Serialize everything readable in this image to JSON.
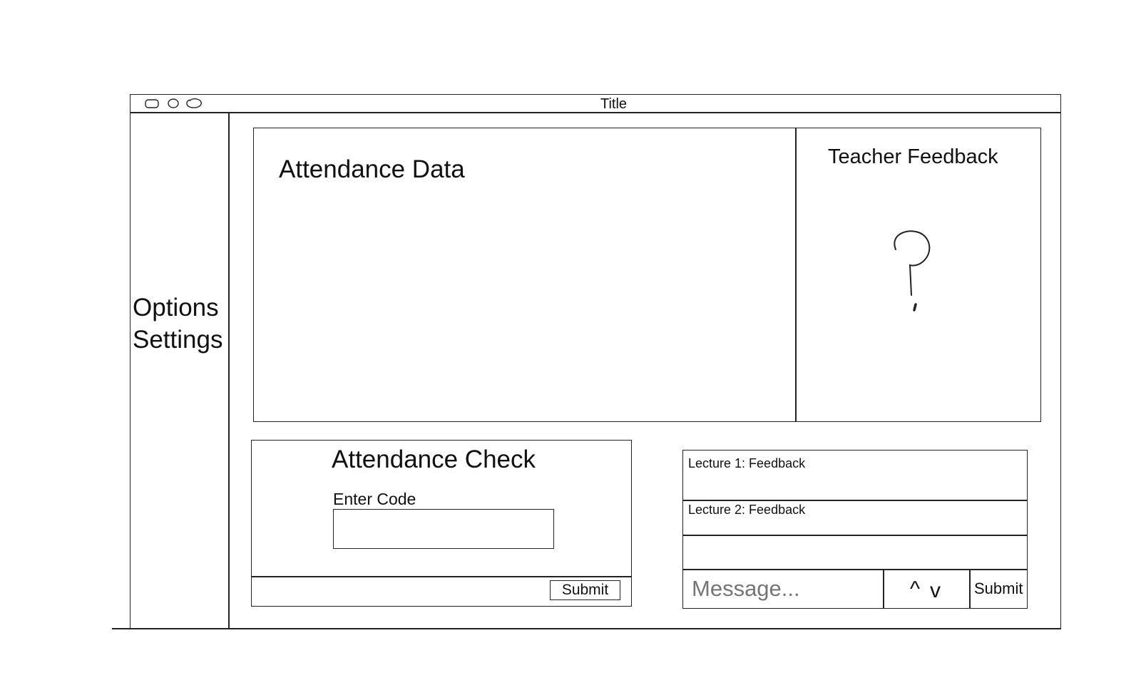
{
  "window": {
    "title": "Title",
    "controls": [
      "close-control",
      "minimize-control",
      "zoom-control"
    ]
  },
  "sidebar": {
    "items": [
      {
        "label": "Options"
      },
      {
        "label": "Settings"
      }
    ]
  },
  "attendance_data": {
    "title": "Attendance Data"
  },
  "teacher_feedback": {
    "title": "Teacher Feedback",
    "placeholder_glyph": "question-mark-sketch"
  },
  "attendance_check": {
    "title": "Attendance Check",
    "code_label": "Enter Code",
    "code_value": "",
    "submit_label": "Submit"
  },
  "feedback_list": {
    "items": [
      {
        "label": "Lecture 1: Feedback"
      },
      {
        "label": "Lecture 2: Feedback"
      }
    ],
    "message_placeholder": "Message...",
    "vote_up": "^",
    "vote_down": "v",
    "submit_label": "Submit"
  }
}
